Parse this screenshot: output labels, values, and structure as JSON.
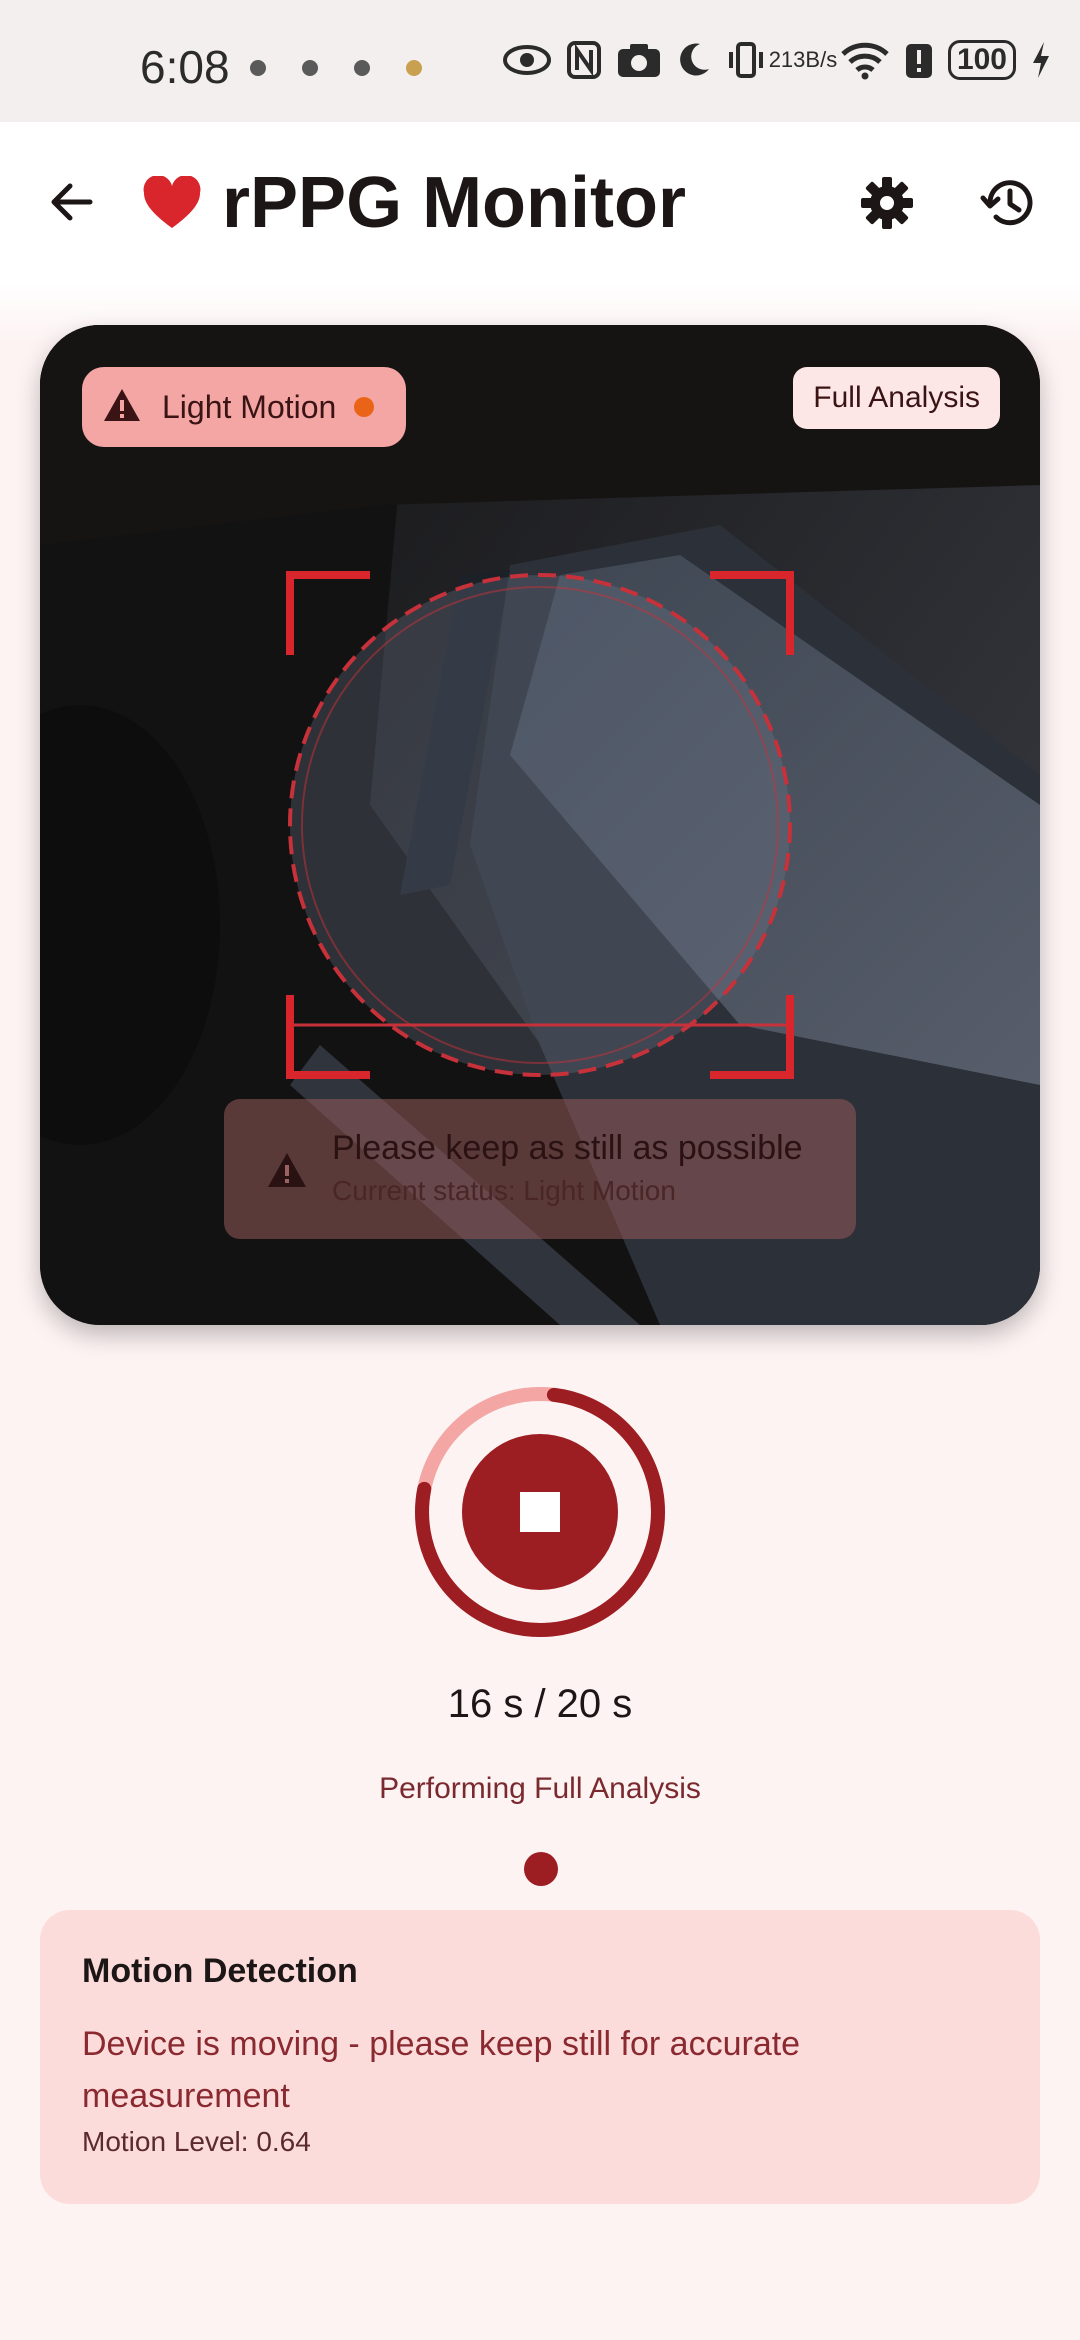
{
  "status_bar": {
    "time": "6:08",
    "net_speed_value": "213",
    "net_speed_unit": "B/s",
    "battery": "100"
  },
  "app_bar": {
    "title": "rPPG Monitor",
    "heart_color": "#d8262c"
  },
  "camera": {
    "motion_badge": "Light Motion",
    "mode_badge": "Full Analysis",
    "banner_title": "Please keep as still as possible",
    "banner_status": "Current status: Light Motion"
  },
  "recording": {
    "elapsed": "16 s / 20 s",
    "progress_fraction": 0.8,
    "phase": "Performing Full Analysis"
  },
  "motion_detection": {
    "heading": "Motion Detection",
    "message": "Device is moving - please keep still for accurate measurement",
    "level": "Motion Level: 0.64"
  },
  "colors": {
    "accent": "#9c1d22",
    "badge_bg": "#f4a6a4",
    "card_bg": "#fcdcdb"
  }
}
